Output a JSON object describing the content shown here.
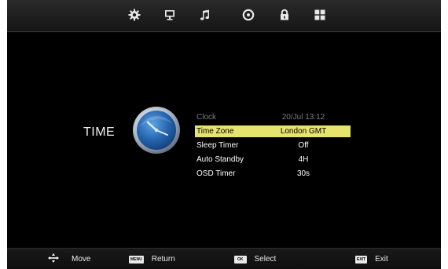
{
  "top_icons": [
    {
      "name": "settings-icon"
    },
    {
      "name": "picture-icon"
    },
    {
      "name": "music-icon"
    },
    {
      "name": "channel-icon"
    },
    {
      "name": "lock-icon"
    },
    {
      "name": "apps-icon"
    }
  ],
  "page": {
    "title": "TIME"
  },
  "menu": {
    "items": [
      {
        "label": "Clock",
        "value": "20/Jul 13:12",
        "state": "disabled"
      },
      {
        "label": "Time Zone",
        "value": "London GMT",
        "state": "selected"
      },
      {
        "label": "Sleep Timer",
        "value": "Off",
        "state": "normal"
      },
      {
        "label": "Auto Standby",
        "value": "4H",
        "state": "normal"
      },
      {
        "label": "OSD Timer",
        "value": "30s",
        "state": "normal"
      }
    ]
  },
  "footer": {
    "move_label": "Move",
    "menu_key": "MENU",
    "return_label": "Return",
    "ok_key": "OK",
    "select_label": "Select",
    "exit_key": "EXIT",
    "exit_label": "Exit"
  },
  "colors": {
    "highlight": "#e6e36e",
    "background": "#000000",
    "text": "#ffffff",
    "disabled_text": "#7c7c7c"
  }
}
